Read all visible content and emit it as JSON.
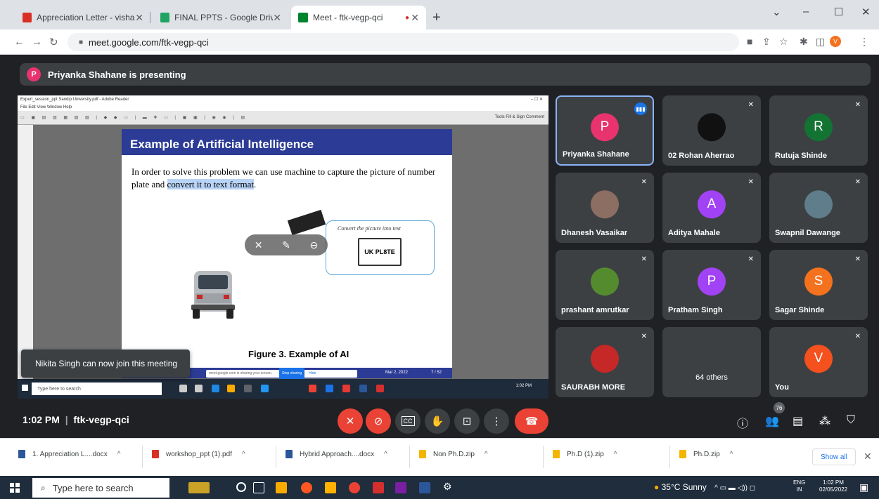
{
  "browser": {
    "tabs": [
      {
        "title": "Appreciation Letter - vishal.mahi",
        "icon": "gmail-icon",
        "color": "#d93025",
        "active": false
      },
      {
        "title": "FINAL PPTS - Google Drive",
        "icon": "drive-icon",
        "color": "#1fa463",
        "active": false
      },
      {
        "title": "Meet - ftk-vegp-qci",
        "icon": "meet-icon",
        "color": "#00832d",
        "active": true
      }
    ],
    "url": "meet.google.com/ftk-vegp-qci"
  },
  "meet": {
    "presenting_banner": "Priyanka Shahane is presenting",
    "presenter_initial": "P",
    "meeting_time": "1:02 PM",
    "meeting_code": "ftk-vegp-qci",
    "people_count": "76",
    "toast": "Nikita Singh can now join this meeting",
    "participants": [
      {
        "name": "Priyanka Shahane",
        "initial": "P",
        "color": "#e8336e",
        "speaking": true,
        "muted": false
      },
      {
        "name": "02 Rohan Aherrao",
        "initial": "",
        "color": "#111111",
        "muted": true
      },
      {
        "name": "Rutuja Shinde",
        "initial": "R",
        "color": "#137333",
        "muted": true
      },
      {
        "name": "Dhanesh Vasaikar",
        "initial": "",
        "color": "#8d6e63",
        "muted": true
      },
      {
        "name": "Aditya Mahale",
        "initial": "A",
        "color": "#a142f4",
        "muted": true
      },
      {
        "name": "Swapnil Dawange",
        "initial": "",
        "color": "#607d8b",
        "muted": true
      },
      {
        "name": "prashant amrutkar",
        "initial": "",
        "color": "#558b2f",
        "muted": true
      },
      {
        "name": "Pratham Singh",
        "initial": "P",
        "color": "#a142f4",
        "muted": true
      },
      {
        "name": "Sagar Shinde",
        "initial": "S",
        "color": "#f4711e",
        "muted": true
      },
      {
        "name": "SAURABH MORE",
        "initial": "",
        "color": "#c62828",
        "muted": true
      },
      {
        "name": "64 others",
        "initial": "",
        "color": "#3c4043",
        "muted": false
      },
      {
        "name": "You",
        "initial": "V",
        "color": "#f4511e",
        "muted": true
      }
    ]
  },
  "shared_screen": {
    "window_title": "Expert_session_ppt Sandip University.pdf - Adobe Reader",
    "menu": "File  Edit  View  Window  Help",
    "tools_right": "Tools    Fill & Sign    Comment",
    "slide_title": "Example of Artificial Intelligence",
    "slide_text_plain": "In order to solve this problem we can use machine to capture the picture of number plate and ",
    "slide_text_highlight": "convert it to text format",
    "slide_text_end": ".",
    "bubble_caption": "Convert the picture into text",
    "plate_text": "UK PL8TE",
    "figure_caption": "Figure 3. Example of AI",
    "slide_date": "Mar 2, 2022",
    "slide_page": "7 / 52",
    "share_notice": "meet.google.com is sharing your screen.",
    "stop_sharing": "Stop sharing",
    "hide": "Hide",
    "inner_search": "Type here to search",
    "inner_clock": "1:02 PM"
  },
  "downloads": [
    {
      "name": "1. Appreciation L....docx",
      "color": "#2b579a"
    },
    {
      "name": "workshop_ppt (1).pdf",
      "color": "#d93025"
    },
    {
      "name": "Hybrid Approach....docx",
      "color": "#2b579a"
    },
    {
      "name": "Non Ph.D.zip",
      "color": "#f2b600"
    },
    {
      "name": "Ph.D (1).zip",
      "color": "#f2b600"
    },
    {
      "name": "Ph.D.zip",
      "color": "#f2b600"
    }
  ],
  "show_all": "Show all",
  "taskbar": {
    "search": "Type here to search",
    "weather": "35°C  Sunny",
    "lang_1": "ENG",
    "lang_2": "IN",
    "time": "1:02 PM",
    "date": "02/05/2022"
  }
}
